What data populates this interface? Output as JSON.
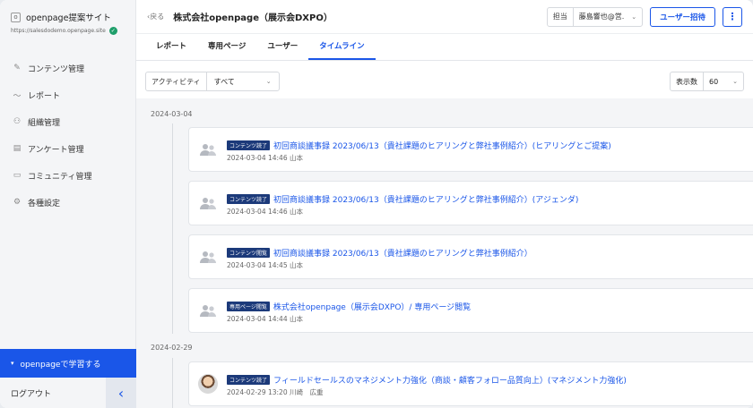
{
  "sidebar": {
    "site_logo": "o",
    "site_name": "openpage提案サイト",
    "site_url": "https://salesdodemo.openpage.site",
    "verified_mark": "✓",
    "items": [
      {
        "icon": "✎",
        "label": "コンテンツ管理"
      },
      {
        "icon": "〜",
        "label": "レポート"
      },
      {
        "icon": "⚇",
        "label": "組織管理"
      },
      {
        "icon": "▤",
        "label": "アンケート管理"
      },
      {
        "icon": "▭",
        "label": "コミュニティ管理"
      },
      {
        "icon": "⚙",
        "label": "各種設定"
      }
    ],
    "learn_caret": "▾",
    "learn_label": "openpageで学習する",
    "logout_label": "ログアウト",
    "collapse_icon": "‹"
  },
  "topbar": {
    "back_label": "‹戻る",
    "title": "株式会社openpage（展示会DXPO）",
    "owner_label": "担当",
    "owner_value": "藤島響也@営.",
    "owner_caret": "⌄",
    "invite_label": "ユーザー招待",
    "more_label": "⋮"
  },
  "tabs": [
    {
      "label": "レポート"
    },
    {
      "label": "専用ページ"
    },
    {
      "label": "ユーザー"
    },
    {
      "label": "タイムライン"
    }
  ],
  "filters": {
    "activity_label": "アクティビティ",
    "activity_value": "すべて",
    "perpage_label": "表示数",
    "perpage_value": "60",
    "caret": "⌄"
  },
  "timeline": {
    "dates": [
      "2024-03-04",
      "2024-02-29"
    ],
    "entries": [
      {
        "badge": "コンテンツ読了",
        "title": "初回商談議事録 2023/06/13（貴社課題のヒアリングと弊社事例紹介）(ヒアリングとご提案)",
        "meta": "2024-03-04 14:46  山本",
        "avatar": "users"
      },
      {
        "badge": "コンテンツ読了",
        "title": "初回商談議事録 2023/06/13（貴社課題のヒアリングと弊社事例紹介）(アジェンダ)",
        "meta": "2024-03-04 14:46  山本",
        "avatar": "users"
      },
      {
        "badge": "コンテンツ閲覧",
        "title": "初回商談議事録 2023/06/13（貴社課題のヒアリングと弊社事例紹介）",
        "meta": "2024-03-04 14:45  山本",
        "avatar": "users"
      },
      {
        "badge": "専用ページ閲覧",
        "title": "株式会社openpage（展示会DXPO）/ 専用ページ閲覧",
        "meta": "2024-03-04 14:44  山本",
        "avatar": "users"
      },
      {
        "badge": "コンテンツ読了",
        "title": "フィールドセールスのマネジメント力強化（商談・顧客フォロー品質向上）(マネジメント力強化)",
        "meta": "2024-02-29 13:20  川崎　広重",
        "avatar": "photo"
      }
    ]
  },
  "colors": {
    "accent": "#1a56e8",
    "badge": "#1c3a7a",
    "verified": "#1e9e6a"
  }
}
